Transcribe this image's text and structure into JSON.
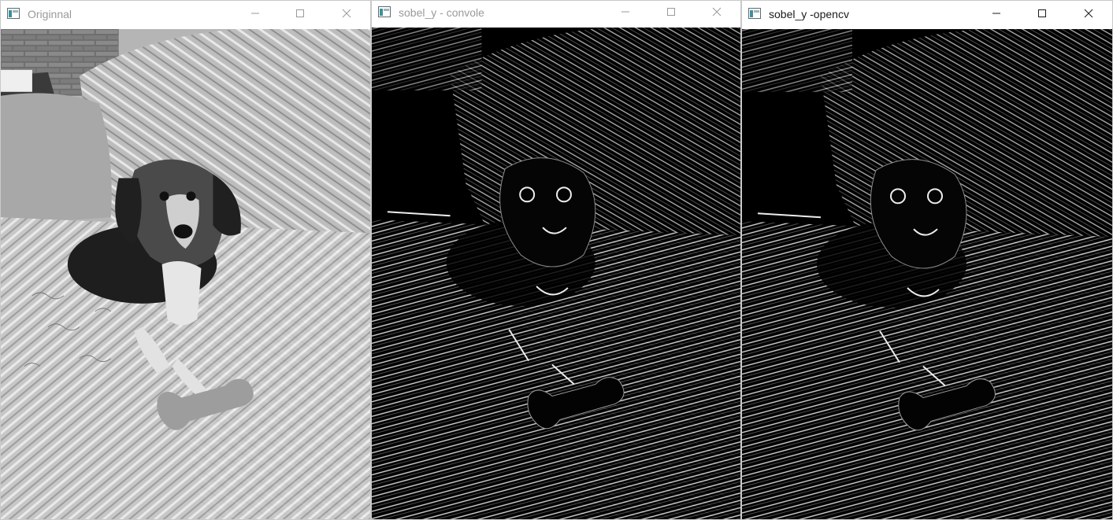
{
  "windows": [
    {
      "title": "Originnal",
      "active": false,
      "content": "grayscale-photo",
      "icon": "app-window-icon"
    },
    {
      "title": "sobel_y - convole",
      "active": false,
      "content": "sobel-y-edges",
      "icon": "app-window-icon"
    },
    {
      "title": "sobel_y -opencv",
      "active": true,
      "content": "sobel-y-edges",
      "icon": "app-window-icon"
    }
  ],
  "controls": {
    "minimize": "minimize-icon",
    "maximize": "maximize-icon",
    "close": "close-icon"
  },
  "colors": {
    "inactive_title": "#9a9a9a",
    "active_title": "#1a1a1a",
    "icon_teal": "#3f8f9a",
    "edge_background": "#000000"
  }
}
